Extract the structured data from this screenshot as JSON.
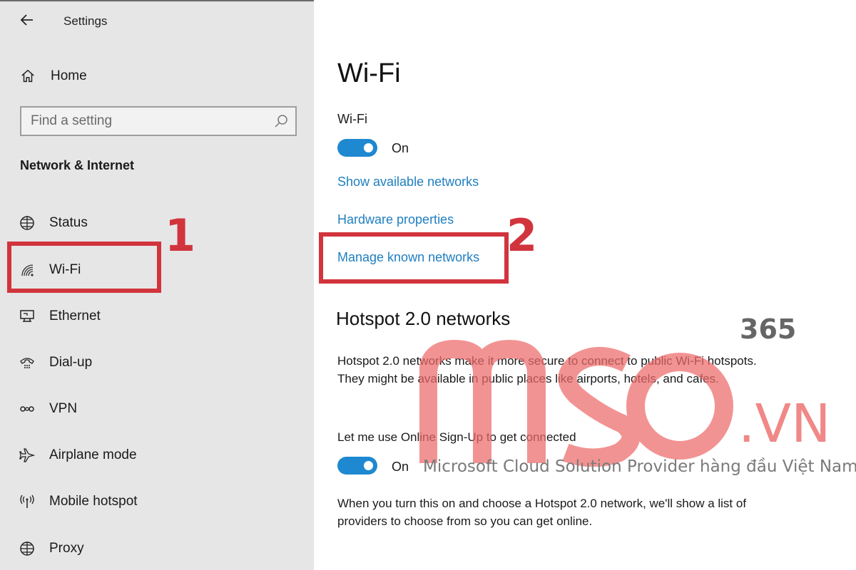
{
  "window": {
    "title": "Settings"
  },
  "sidebar": {
    "home_label": "Home",
    "search_placeholder": "Find a setting",
    "section_title": "Network & Internet",
    "items": [
      {
        "label": "Status",
        "icon": "globe-icon"
      },
      {
        "label": "Wi-Fi",
        "icon": "wifi-icon",
        "selected": true
      },
      {
        "label": "Ethernet",
        "icon": "ethernet-icon"
      },
      {
        "label": "Dial-up",
        "icon": "dial-up-icon"
      },
      {
        "label": "VPN",
        "icon": "vpn-icon"
      },
      {
        "label": "Airplane mode",
        "icon": "airplane-icon"
      },
      {
        "label": "Mobile hotspot",
        "icon": "hotspot-icon"
      },
      {
        "label": "Proxy",
        "icon": "globe-icon"
      }
    ]
  },
  "main": {
    "title": "Wi-Fi",
    "wifi_label": "Wi-Fi",
    "wifi_toggle": {
      "state": "On",
      "on": true
    },
    "links": {
      "show_networks": "Show available networks",
      "hardware_properties": "Hardware properties",
      "manage_known": "Manage known networks"
    },
    "hotspot": {
      "heading": "Hotspot 2.0 networks",
      "description": "Hotspot 2.0 networks make it more secure to connect to public Wi-Fi hotspots. They might be available in public places like airports, hotels, and cafes.",
      "online_signup_label": "Let me use Online Sign-Up to get connected",
      "online_toggle": {
        "state": "On",
        "on": true
      },
      "note": "When you turn this on and choose a Hotspot 2.0 network, we'll show a list of providers to choose from so you can get online."
    }
  },
  "annotations": {
    "step1": "1",
    "step2": "2",
    "color": "#d1343d"
  },
  "watermark": {
    "brand": "MSO",
    "number": "365",
    "domain": ".VN",
    "tagline": "Microsoft Cloud Solution Provider hàng đầu Việt Nam"
  },
  "colors": {
    "sidebar_bg": "#e6e6e6",
    "accent": "#1e88d0",
    "link": "#1f7fbf",
    "highlight": "#d1343d"
  }
}
